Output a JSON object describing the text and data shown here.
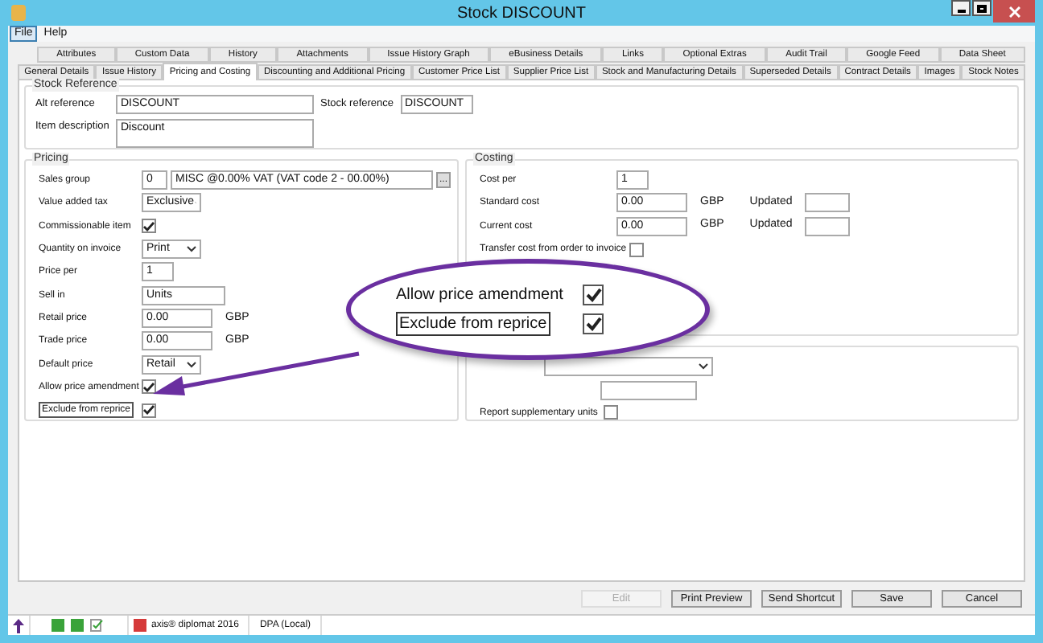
{
  "window": {
    "title": "Stock DISCOUNT"
  },
  "menu": [
    {
      "label": "File",
      "selected": true
    },
    {
      "label": "Help",
      "selected": false
    }
  ],
  "tab_rows": [
    [
      {
        "label": "Attributes",
        "selected": false
      },
      {
        "label": "Custom Data",
        "selected": false
      },
      {
        "label": "History",
        "selected": false
      },
      {
        "label": "Attachments",
        "selected": false
      },
      {
        "label": "Issue History Graph",
        "selected": false
      },
      {
        "label": "eBusiness Details",
        "selected": false
      },
      {
        "label": "Links",
        "selected": false
      },
      {
        "label": "Optional Extras",
        "selected": false
      },
      {
        "label": "Audit Trail",
        "selected": false
      },
      {
        "label": "Google Feed",
        "selected": false
      },
      {
        "label": "Data Sheet",
        "selected": false
      }
    ],
    [
      {
        "label": "General Details",
        "selected": false
      },
      {
        "label": "Issue History",
        "selected": false
      },
      {
        "label": "Pricing and Costing",
        "selected": true
      },
      {
        "label": "Discounting and Additional Pricing",
        "selected": false
      },
      {
        "label": "Customer Price List",
        "selected": false
      },
      {
        "label": "Supplier Price List",
        "selected": false
      },
      {
        "label": "Stock and Manufacturing Details",
        "selected": false
      },
      {
        "label": "Superseded Details",
        "selected": false
      },
      {
        "label": "Contract Details",
        "selected": false
      },
      {
        "label": "Images",
        "selected": false
      },
      {
        "label": "Stock Notes",
        "selected": false
      }
    ]
  ],
  "stock_reference": {
    "title": "Stock Reference",
    "alt_reference": {
      "label": "Alt reference",
      "value": "DISCOUNT"
    },
    "stock_reference": {
      "label": "Stock reference",
      "value": "DISCOUNT"
    },
    "item_description": {
      "label": "Item description",
      "value": "Discount"
    }
  },
  "pricing": {
    "title": "Pricing",
    "rows": [
      {
        "kind": "group",
        "label": "Sales group",
        "code": "0",
        "value": "MISC @0.00% VAT (VAT code 2 - 00.00%)",
        "button": "..."
      },
      {
        "kind": "select",
        "label": "Value added tax",
        "value": "Exclusive"
      },
      {
        "kind": "check",
        "label": "Commissionable item",
        "checked": true
      },
      {
        "kind": "select",
        "label": "Quantity on invoice",
        "value": "Print"
      },
      {
        "kind": "short",
        "label": "Price per",
        "value": "1"
      },
      {
        "kind": "text",
        "label": "Sell in",
        "value": "Units"
      },
      {
        "kind": "money",
        "label": "Retail price",
        "value": "0.00",
        "unit": "GBP"
      },
      {
        "kind": "money",
        "label": "Trade price",
        "value": "0.00",
        "unit": "GBP"
      },
      {
        "kind": "select",
        "label": "Default price",
        "value": "Retail"
      },
      {
        "kind": "check",
        "label": "Allow price amendment",
        "checked": true
      },
      {
        "kind": "check",
        "label": "Exclude from reprice",
        "checked": true,
        "focused": true
      }
    ]
  },
  "costing": {
    "title": "Costing",
    "rows": [
      {
        "kind": "short",
        "label": "Cost per",
        "value": "1"
      },
      {
        "kind": "money",
        "label": "Standard cost",
        "value": "0.00",
        "unit": "GBP",
        "updated": "Updated"
      },
      {
        "kind": "money",
        "label": "Current cost",
        "value": "0.00",
        "unit": "GBP",
        "updated": "Updated"
      },
      {
        "kind": "check",
        "label": "Transfer cost from order to invoice",
        "checked": false
      }
    ]
  },
  "other": {
    "rows": [
      {
        "kind": "check",
        "label": "Report supplementary units",
        "checked": false
      }
    ]
  },
  "callout": {
    "rows": [
      {
        "label": "Allow price amendment",
        "checked": true,
        "focused": false
      },
      {
        "label": "Exclude from reprice",
        "checked": true,
        "focused": true
      }
    ]
  },
  "buttons": [
    {
      "label": "Edit",
      "disabled": true
    },
    {
      "label": "Print Preview",
      "disabled": false
    },
    {
      "label": "Send Shortcut",
      "disabled": false
    },
    {
      "label": "Save",
      "disabled": false
    },
    {
      "label": "Cancel",
      "disabled": false
    }
  ],
  "status_bar": {
    "product": "axis® diplomat 2016",
    "database": "DPA (Local)"
  }
}
